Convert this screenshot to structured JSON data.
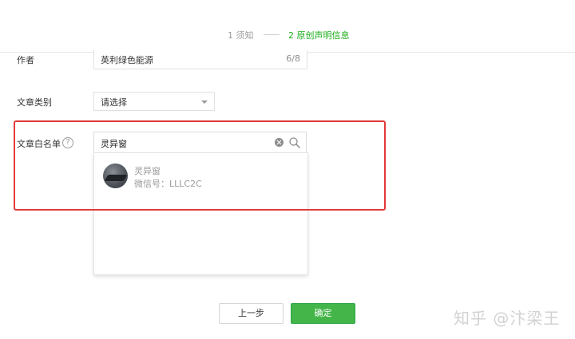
{
  "steps": {
    "step1": "1 须知",
    "step2": "2 原创声明信息"
  },
  "form": {
    "author": {
      "label": "作者",
      "value": "英利绿色能源",
      "count": "6/8"
    },
    "category": {
      "label": "文章类别",
      "selected": "请选择"
    },
    "whitelist": {
      "label": "文章白名单",
      "help_symbol": "?",
      "search_value": "灵异窗"
    }
  },
  "dropdown": {
    "results": [
      {
        "name": "灵异窗",
        "wechat_id": "微信号：LLLC2C"
      }
    ]
  },
  "buttons": {
    "prev": "上一步",
    "confirm": "确定"
  },
  "watermark": "知乎 @汴梁王",
  "colors": {
    "accent_green": "#44b549",
    "step_active": "#1aad19",
    "highlight_red": "#e23a3a"
  },
  "icons": [
    "clear-icon",
    "search-icon",
    "help-icon",
    "chevron-down-icon"
  ]
}
